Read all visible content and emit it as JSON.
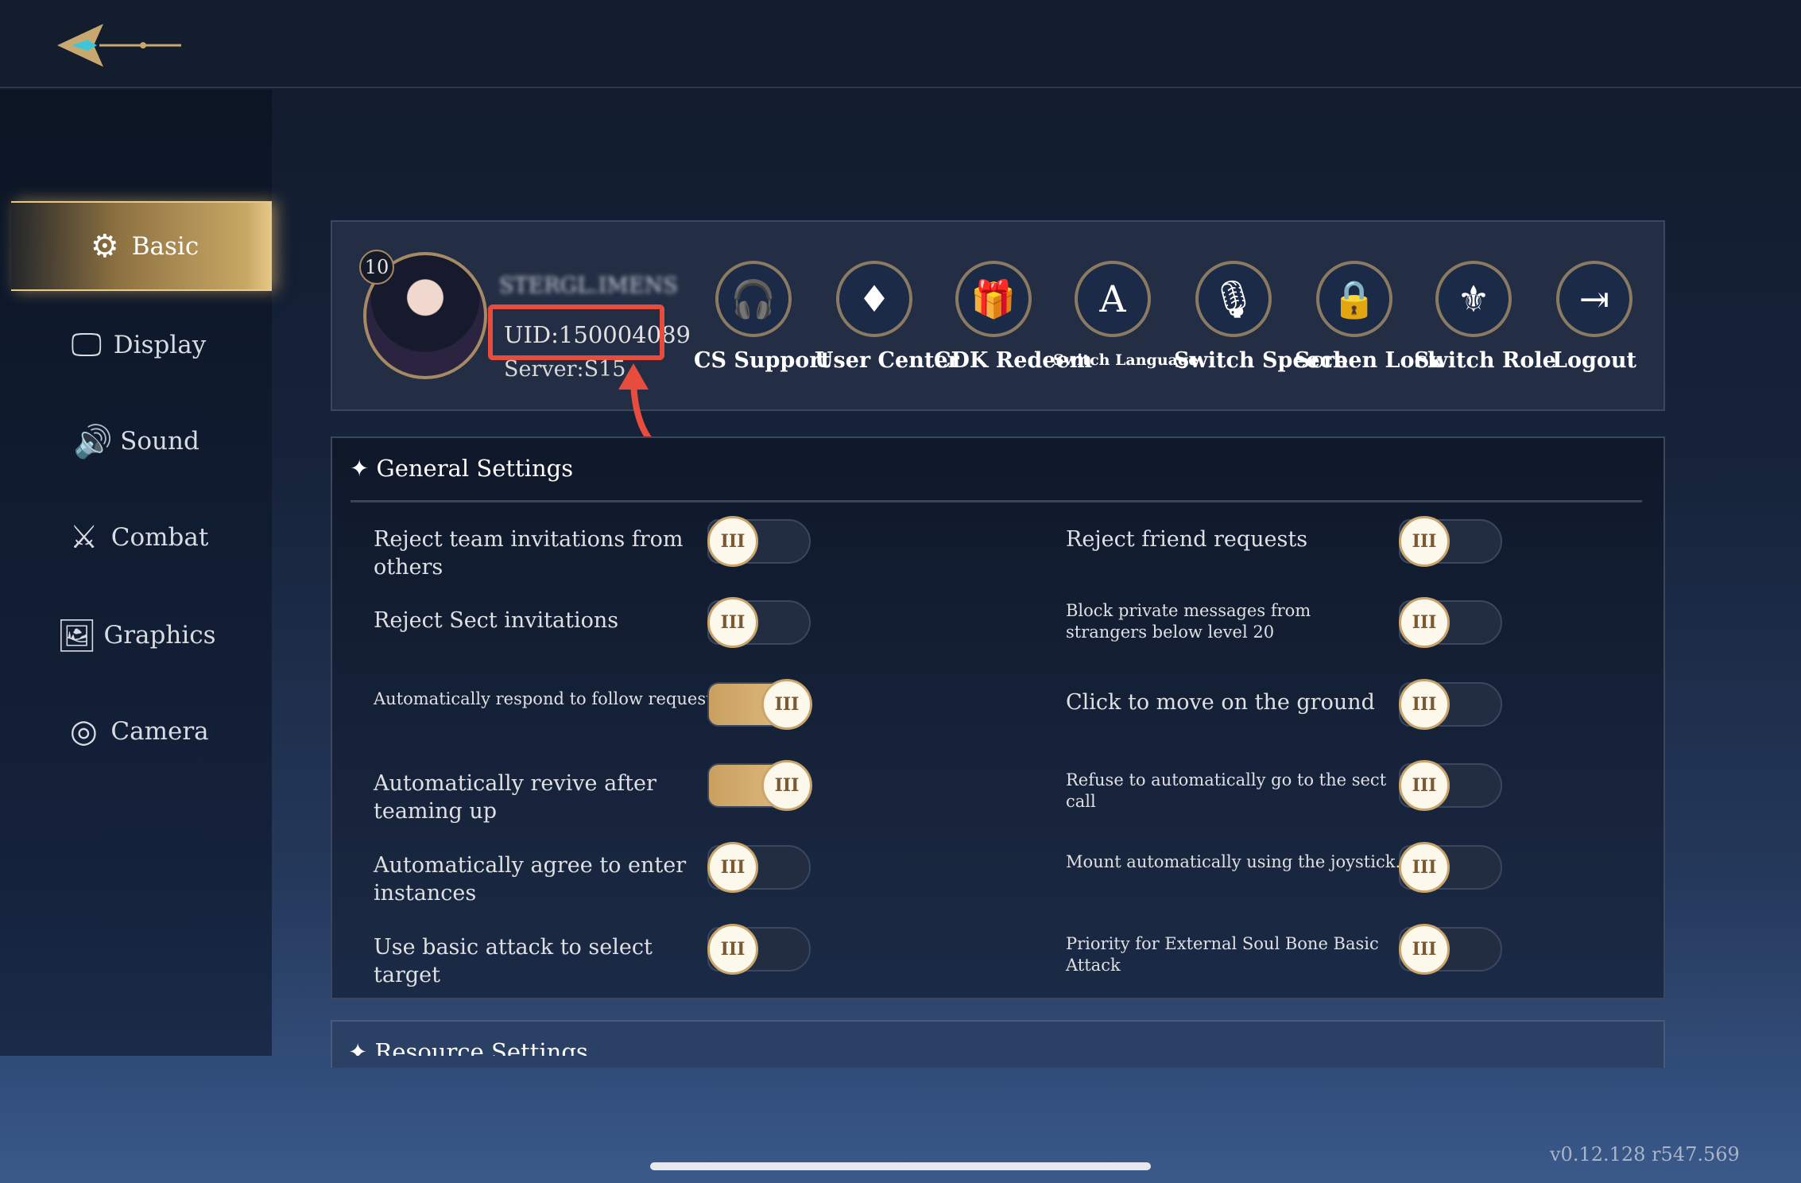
{
  "sidebar": {
    "items": [
      {
        "label": "Basic",
        "icon": "gears-icon",
        "glyph": "⚙",
        "active": true
      },
      {
        "label": "Display",
        "icon": "monitor-icon",
        "glyph": "🖵",
        "active": false
      },
      {
        "label": "Sound",
        "icon": "speaker-icon",
        "glyph": "🔊",
        "active": false
      },
      {
        "label": "Combat",
        "icon": "sword-gear-icon",
        "glyph": "⚔",
        "active": false
      },
      {
        "label": "Graphics",
        "icon": "picture-icon",
        "glyph": "🖼",
        "active": false
      },
      {
        "label": "Camera",
        "icon": "camera-icon",
        "glyph": "◎",
        "active": false
      }
    ]
  },
  "profile": {
    "level": "10",
    "name": "STERGL.IMENS",
    "uid": "UID:150004089",
    "server": "Server:S15"
  },
  "actions": [
    {
      "label": "CS Support",
      "icon": "headphones-icon",
      "glyph": "🎧"
    },
    {
      "label": "User Center",
      "icon": "user-center-icon",
      "glyph": "♦"
    },
    {
      "label": "CDK Redeem",
      "icon": "gift-icon",
      "glyph": "🎁"
    },
    {
      "label": "Switch Language",
      "icon": "language-icon",
      "glyph": "A"
    },
    {
      "label": "Switch Speech",
      "icon": "microphone-icon",
      "glyph": "🎙"
    },
    {
      "label": "Screen Lock",
      "icon": "lock-rotate-icon",
      "glyph": "🔒"
    },
    {
      "label": "Switch Role",
      "icon": "role-emblem-icon",
      "glyph": "⚜"
    },
    {
      "label": "Logout",
      "icon": "logout-icon",
      "glyph": "⇥"
    }
  ],
  "general": {
    "title": "General Settings",
    "knob_glyph": "III",
    "left": [
      {
        "label": "Reject team invitations from others",
        "on": false
      },
      {
        "label": "Reject Sect invitations",
        "on": false
      },
      {
        "label": "Automatically respond to follow requests",
        "on": true
      },
      {
        "label": "Automatically revive after teaming up",
        "on": true
      },
      {
        "label": "Automatically agree to enter instances",
        "on": false
      },
      {
        "label": "Use basic attack to select target",
        "on": false
      }
    ],
    "right": [
      {
        "label": "Reject friend requests",
        "on": false
      },
      {
        "label": "Block private messages from strangers below level 20",
        "on": false
      },
      {
        "label": "Click to move on the ground",
        "on": false
      },
      {
        "label": "Refuse to automatically go to the sect call",
        "on": false
      },
      {
        "label": "Mount automatically using the joystick.",
        "on": false
      },
      {
        "label": "Priority for External Soul Bone Basic Attack",
        "on": false
      }
    ]
  },
  "resource": {
    "title": "Resource Settings"
  },
  "version": "v0.12.128 r547.569",
  "colors": {
    "accent": "#c9a060",
    "annotation": "#e74c3c",
    "background": "#16233a"
  }
}
